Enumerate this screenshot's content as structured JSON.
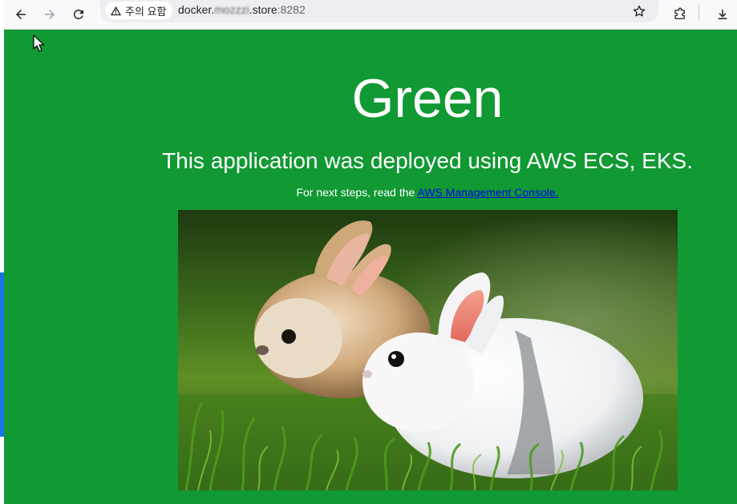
{
  "browser": {
    "security_label": "주의 요함",
    "url_host_start": "docker.",
    "url_host_blurred": "mozzzi",
    "url_host_end": ".store",
    "url_port": ":8282",
    "icons": [
      "back-arrow-icon",
      "forward-arrow-icon",
      "reload-icon",
      "warning-icon",
      "bookmark-star-icon",
      "extensions-icon",
      "download-icon"
    ]
  },
  "page": {
    "background_color": "#119933",
    "heading": "Green",
    "subheading": "This application was deployed using AWS ECS, EKS.",
    "steps_prefix": "For next steps, read the ",
    "steps_link": "AWS Management Console."
  },
  "image": {
    "description_icon": "rabbits-photo"
  }
}
